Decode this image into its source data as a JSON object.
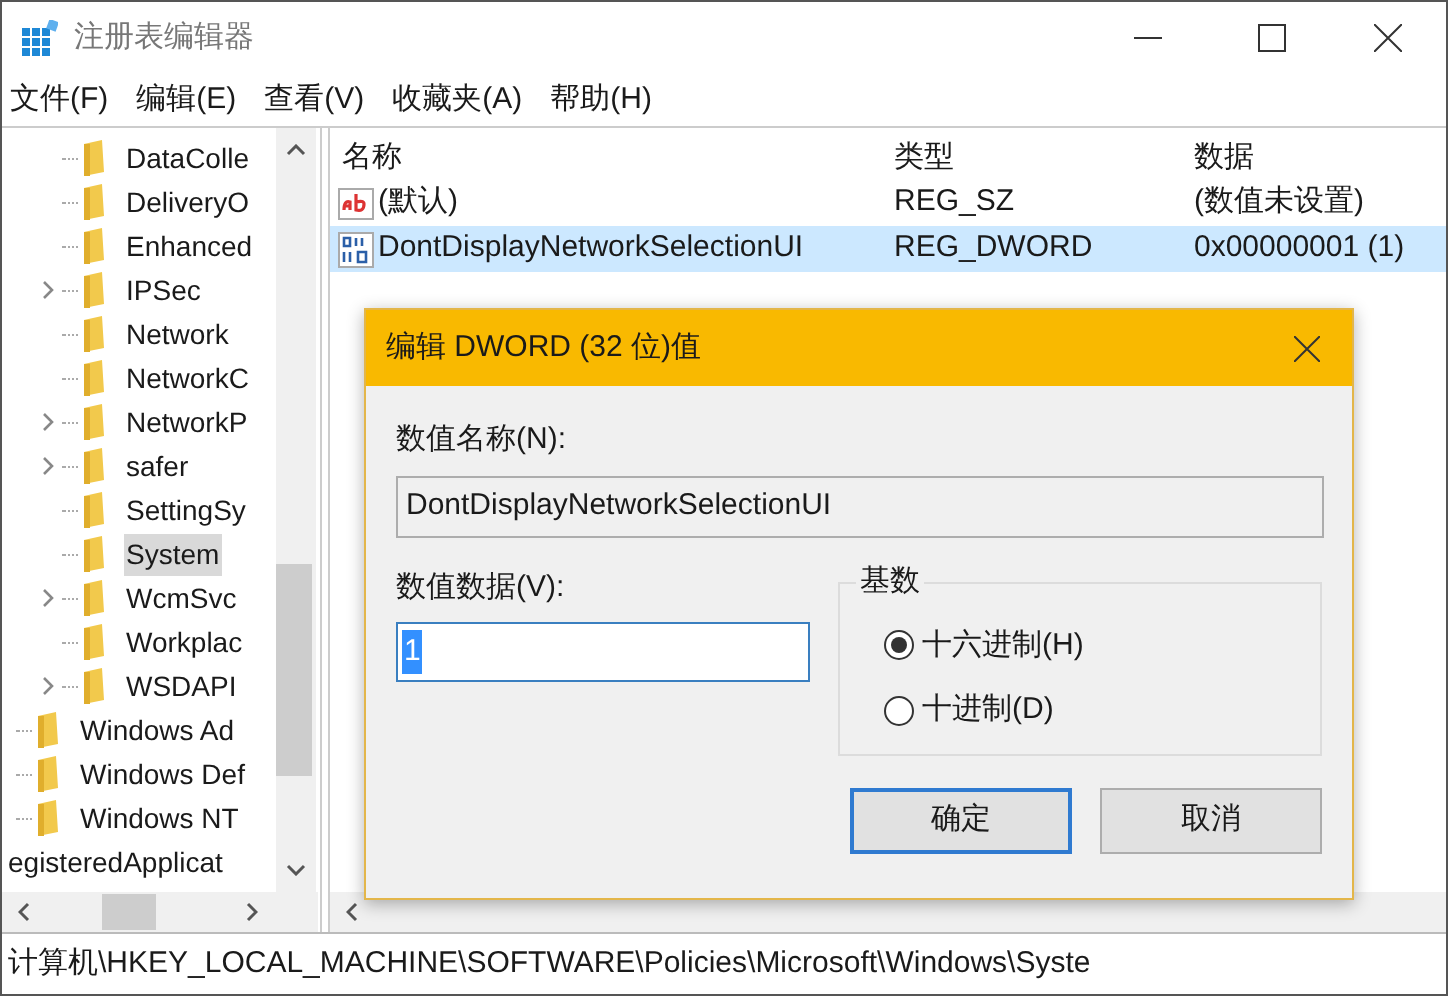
{
  "window": {
    "title": "注册表编辑器"
  },
  "menu": [
    {
      "label": "文件(F)"
    },
    {
      "label": "编辑(E)"
    },
    {
      "label": "查看(V)"
    },
    {
      "label": "收藏夹(A)"
    },
    {
      "label": "帮助(H)"
    }
  ],
  "tree": {
    "items": [
      {
        "children": [
          {
            "children": [
              {
                "label": "DataColle",
                "expandable": false,
                "selected": false
              },
              {
                "label": "DeliveryO",
                "expandable": false,
                "selected": false
              },
              {
                "label": "Enhanced",
                "expandable": false,
                "selected": false
              },
              {
                "label": "IPSec",
                "expandable": true,
                "selected": false
              },
              {
                "label": "Network",
                "expandable": false,
                "selected": false
              },
              {
                "label": "NetworkC",
                "expandable": false,
                "selected": false
              },
              {
                "label": "NetworkP",
                "expandable": true,
                "selected": false
              },
              {
                "label": "safer",
                "expandable": true,
                "selected": false
              },
              {
                "label": "SettingSy",
                "expandable": false,
                "selected": false
              },
              {
                "label": "System",
                "expandable": false,
                "selected": true
              },
              {
                "label": "WcmSvc",
                "expandable": true,
                "selected": false
              },
              {
                "label": "Workplac",
                "expandable": false,
                "selected": false
              },
              {
                "label": "WSDAPI",
                "expandable": true,
                "selected": false
              }
            ]
          },
          {
            "label": "Windows Ad",
            "expandable": false,
            "selected": false
          },
          {
            "label": "Windows Def",
            "expandable": false,
            "selected": false
          },
          {
            "label": "Windows NT",
            "expandable": false,
            "selected": false
          }
        ]
      },
      {
        "label": "egisteredApplicat",
        "expandable": false,
        "selected": false
      }
    ]
  },
  "values": {
    "columns": [
      "名称",
      "类型",
      "数据"
    ],
    "rows": [
      {
        "kind": "string",
        "name": "(默认)",
        "type": "REG_SZ",
        "data": "(数值未设置)",
        "selected": false
      },
      {
        "kind": "binary",
        "name": "DontDisplayNetworkSelectionUI",
        "type": "REG_DWORD",
        "data": "0x00000001 (1)",
        "selected": true
      }
    ]
  },
  "dialog": {
    "title": "编辑 DWORD (32 位)值",
    "name_label": "数值名称(N):",
    "name_value": "DontDisplayNetworkSelectionUI",
    "data_label": "数值数据(V):",
    "data_value": "1",
    "base": {
      "title": "基数",
      "options": [
        {
          "label": "十六进制(H)",
          "selected": true
        },
        {
          "label": "十进制(D)",
          "selected": false
        }
      ]
    },
    "buttons": [
      {
        "label": "确定",
        "default": true
      },
      {
        "label": "取消",
        "default": false
      }
    ]
  },
  "status_bar": "计算机\\HKEY_LOCAL_MACHINE\\SOFTWARE\\Policies\\Microsoft\\Windows\\Syste"
}
